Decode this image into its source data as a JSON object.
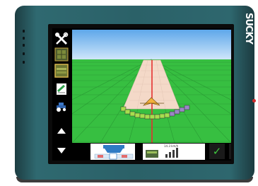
{
  "device": {
    "brand": "SUCKY",
    "colors": {
      "case": "#2b6168",
      "screen_bezel": "#0b0b0b",
      "sky": "#7ebaf0",
      "field": "#37bf41"
    }
  },
  "sidebar": {
    "items": [
      {
        "name": "tools-icon"
      },
      {
        "name": "map-icon"
      },
      {
        "name": "field-image-icon"
      },
      {
        "name": "notes-icon"
      },
      {
        "name": "tractor-icon"
      },
      {
        "name": "scroll-up-icon"
      },
      {
        "name": "scroll-down-icon"
      }
    ]
  },
  "guidance_view": {
    "colors": {
      "guidance_line": "#e53030",
      "swath": "#f4d9c8",
      "sections_active": "#a7de4f",
      "sections_inactive": "#9b86c6",
      "vehicle": "#f3b13b"
    }
  },
  "bottom_bar": {
    "speed_text": "14.3 km/h",
    "confirm_label": "✓",
    "cancel_label": "✕",
    "colors": {
      "confirm": "#3fc63f",
      "cancel": "#e4262b"
    }
  }
}
